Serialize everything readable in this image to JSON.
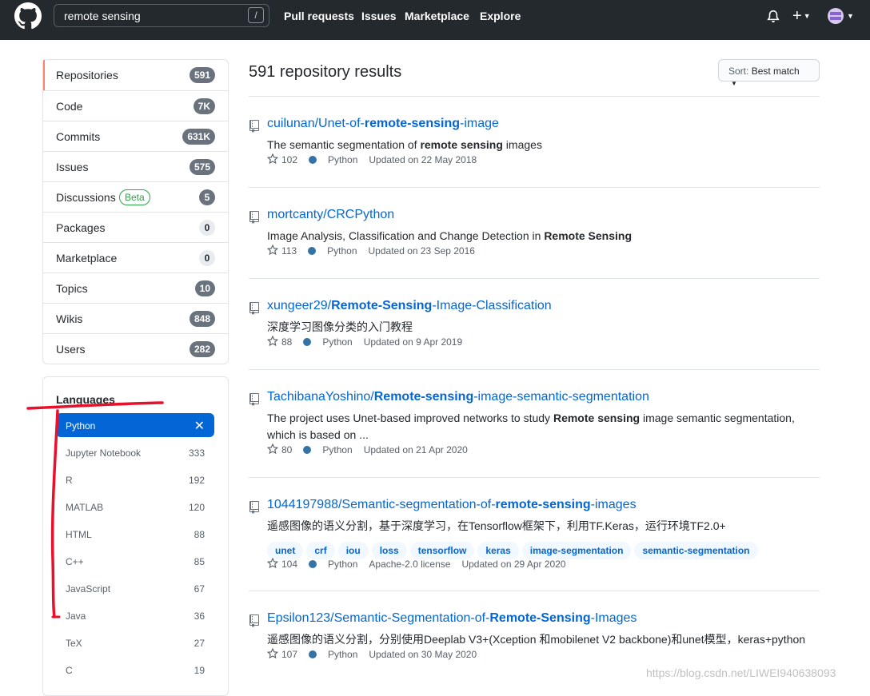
{
  "header": {
    "search_value": "remote sensing",
    "slash_hint": "/",
    "nav": [
      "Pull requests",
      "Issues",
      "Marketplace",
      "Explore"
    ],
    "plus_label": "+"
  },
  "sidebar": {
    "items": [
      {
        "label": "Repositories",
        "count": "591",
        "style": "dark",
        "selected": true
      },
      {
        "label": "Code",
        "count": "7K",
        "style": "dark"
      },
      {
        "label": "Commits",
        "count": "631K",
        "style": "dark"
      },
      {
        "label": "Issues",
        "count": "575",
        "style": "dark"
      },
      {
        "label": "Discussions",
        "count": "5",
        "style": "dark",
        "badge": "Beta"
      },
      {
        "label": "Packages",
        "count": "0",
        "style": "light"
      },
      {
        "label": "Marketplace",
        "count": "0",
        "style": "light"
      },
      {
        "label": "Topics",
        "count": "10",
        "style": "dark"
      },
      {
        "label": "Wikis",
        "count": "848",
        "style": "dark"
      },
      {
        "label": "Users",
        "count": "282",
        "style": "dark"
      }
    ],
    "languages_title": "Languages",
    "languages": [
      {
        "name": "Python",
        "active": true,
        "clear": "✕"
      },
      {
        "name": "Jupyter Notebook",
        "count": "333"
      },
      {
        "name": "R",
        "count": "192"
      },
      {
        "name": "MATLAB",
        "count": "120"
      },
      {
        "name": "HTML",
        "count": "88"
      },
      {
        "name": "C++",
        "count": "85"
      },
      {
        "name": "JavaScript",
        "count": "67"
      },
      {
        "name": "Java",
        "count": "36"
      },
      {
        "name": "TeX",
        "count": "27"
      },
      {
        "name": "C",
        "count": "19"
      }
    ]
  },
  "results": {
    "title": "591 repository results",
    "sort_prefix": "Sort: ",
    "sort_value": "Best match",
    "repos": [
      {
        "title_parts": [
          [
            "cuilunan/Unet-of-",
            false
          ],
          [
            "remote-sensing",
            true
          ],
          [
            "-image",
            false
          ]
        ],
        "desc_parts": [
          [
            "The semantic segmentation of ",
            false
          ],
          [
            "remote sensing",
            true
          ],
          [
            " images",
            false
          ]
        ],
        "stars": "102",
        "language": "Python",
        "license": "",
        "updated": "Updated on 22 May 2018",
        "topics": []
      },
      {
        "title_parts": [
          [
            "mortcanty/CRCPython",
            false
          ]
        ],
        "desc_parts": [
          [
            "Image Analysis, Classification and Change Detection in ",
            false
          ],
          [
            "Remote Sensing",
            true
          ]
        ],
        "stars": "113",
        "language": "Python",
        "license": "",
        "updated": "Updated on 23 Sep 2016",
        "topics": []
      },
      {
        "title_parts": [
          [
            "xungeer29/",
            false
          ],
          [
            "Remote-Sensing",
            true
          ],
          [
            "-Image-Classification",
            false
          ]
        ],
        "desc_parts": [
          [
            "深度学习图像分类的入门教程",
            false
          ]
        ],
        "stars": "88",
        "language": "Python",
        "license": "",
        "updated": "Updated on 9 Apr 2019",
        "topics": []
      },
      {
        "title_parts": [
          [
            "TachibanaYoshino/",
            false
          ],
          [
            "Remote-sensing",
            true
          ],
          [
            "-image-semantic-segmentation",
            false
          ]
        ],
        "desc_parts": [
          [
            "The project uses Unet-based improved networks to study ",
            false
          ],
          [
            "Remote sensing",
            true
          ],
          [
            " image semantic segmentation, which is based on ...",
            false
          ]
        ],
        "stars": "80",
        "language": "Python",
        "license": "",
        "updated": "Updated on 21 Apr 2020",
        "topics": []
      },
      {
        "title_parts": [
          [
            "1044197988/Semantic-segmentation-of-",
            false
          ],
          [
            "remote-sensing",
            true
          ],
          [
            "-images",
            false
          ]
        ],
        "desc_parts": [
          [
            "遥感图像的语义分割，基于深度学习，在Tensorflow框架下，利用TF.Keras，运行环境TF2.0+",
            false
          ]
        ],
        "stars": "104",
        "language": "Python",
        "license": "Apache-2.0 license",
        "updated": "Updated on 29 Apr 2020",
        "topics": [
          "unet",
          "crf",
          "iou",
          "loss",
          "tensorflow",
          "keras",
          "image-segmentation",
          "semantic-segmentation"
        ]
      },
      {
        "title_parts": [
          [
            "Epsilon123/Semantic-Segmentation-of-",
            false
          ],
          [
            "Remote-Sensing",
            true
          ],
          [
            "-Images",
            false
          ]
        ],
        "desc_parts": [
          [
            "遥感图像的语义分割，分别使用Deeplab V3+(Xception 和mobilenet V2 backbone)和unet模型，keras+python",
            false
          ]
        ],
        "stars": "107",
        "language": "Python",
        "license": "",
        "updated": "Updated on 30 May 2020",
        "topics": []
      }
    ]
  },
  "watermark": "https://blog.csdn.net/LIWEI940638093",
  "colors": {
    "accent": "#0366d6",
    "header_bg": "#24292e",
    "python": "#3572A5",
    "annotation": "#e8102a"
  }
}
